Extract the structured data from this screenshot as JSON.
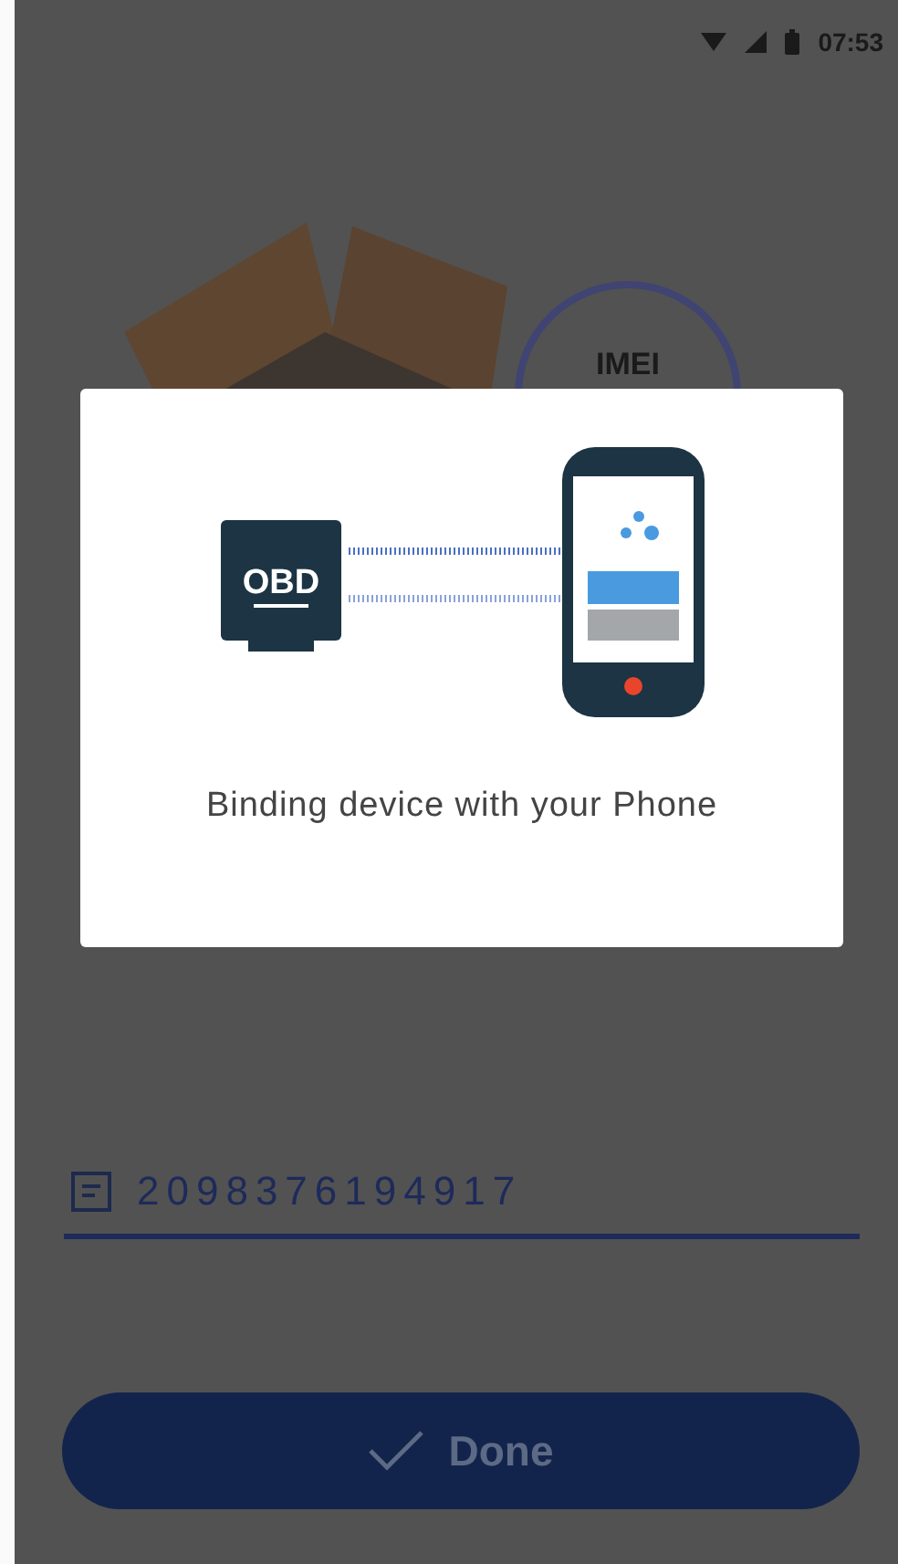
{
  "status_bar": {
    "time": "07:53"
  },
  "screen": {
    "badge_label": "IMEI",
    "field": {
      "value": "2098376194917"
    },
    "button": {
      "label": "Done"
    }
  },
  "dialog": {
    "device_label": "OBD",
    "message": "Binding device with your Phone"
  }
}
